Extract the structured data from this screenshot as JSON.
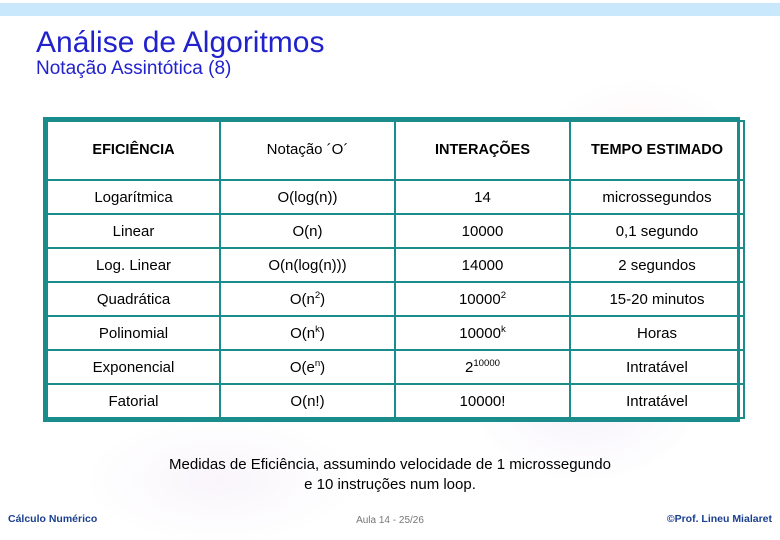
{
  "theme": {
    "banner_color": "#c9e8fb",
    "title_color": "#2222cc",
    "table_border_color": "#1a8c8c",
    "footer_accent_color": "#1a3f8f"
  },
  "header": {
    "title": "Análise de Algoritmos",
    "subtitle": "Notação Assintótica (8)"
  },
  "table": {
    "columns": [
      "EFICIÊNCIA",
      "Notação ´O´",
      "INTERAÇÕES",
      "TEMPO ESTIMADO"
    ],
    "rows": [
      {
        "eficiencia": "Logarítmica",
        "notacao_base": "O(log(n))",
        "notacao_sup": "",
        "interacoes_base": "14",
        "interacoes_sup": "",
        "tempo": "microssegundos"
      },
      {
        "eficiencia": "Linear",
        "notacao_base": "O(n)",
        "notacao_sup": "",
        "interacoes_base": "10000",
        "interacoes_sup": "",
        "tempo": "0,1 segundo"
      },
      {
        "eficiencia": "Log. Linear",
        "notacao_base": "O(n(log(n)))",
        "notacao_sup": "",
        "interacoes_base": "14000",
        "interacoes_sup": "",
        "tempo": "2 segundos"
      },
      {
        "eficiencia": "Quadrática",
        "notacao_base": "O(n",
        "notacao_sup": "2",
        "notacao_tail": ")",
        "interacoes_base": "10000",
        "interacoes_sup": "2",
        "tempo": "15-20 minutos"
      },
      {
        "eficiencia": "Polinomial",
        "notacao_base": "O(n",
        "notacao_sup": "k",
        "notacao_tail": ")",
        "interacoes_base": "10000",
        "interacoes_sup": "k",
        "tempo": "Horas"
      },
      {
        "eficiencia": "Exponencial",
        "notacao_base": "O(e",
        "notacao_sup": "n",
        "notacao_tail": ")",
        "interacoes_base": "2",
        "interacoes_sup": "10000",
        "tempo": "Intratável"
      },
      {
        "eficiencia": "Fatorial",
        "notacao_base": "O(n!)",
        "notacao_sup": "",
        "interacoes_base": "10000!",
        "interacoes_sup": "",
        "tempo": "Intratável"
      }
    ]
  },
  "caption": {
    "line1": "Medidas de Eficiência, assumindo velocidade de 1 microssegundo",
    "line2": "e 10 instruções num loop."
  },
  "footer": {
    "left": "Cálculo Numérico",
    "center": "Aula 14 - 25/26",
    "right": "©Prof. Lineu Mialaret"
  }
}
